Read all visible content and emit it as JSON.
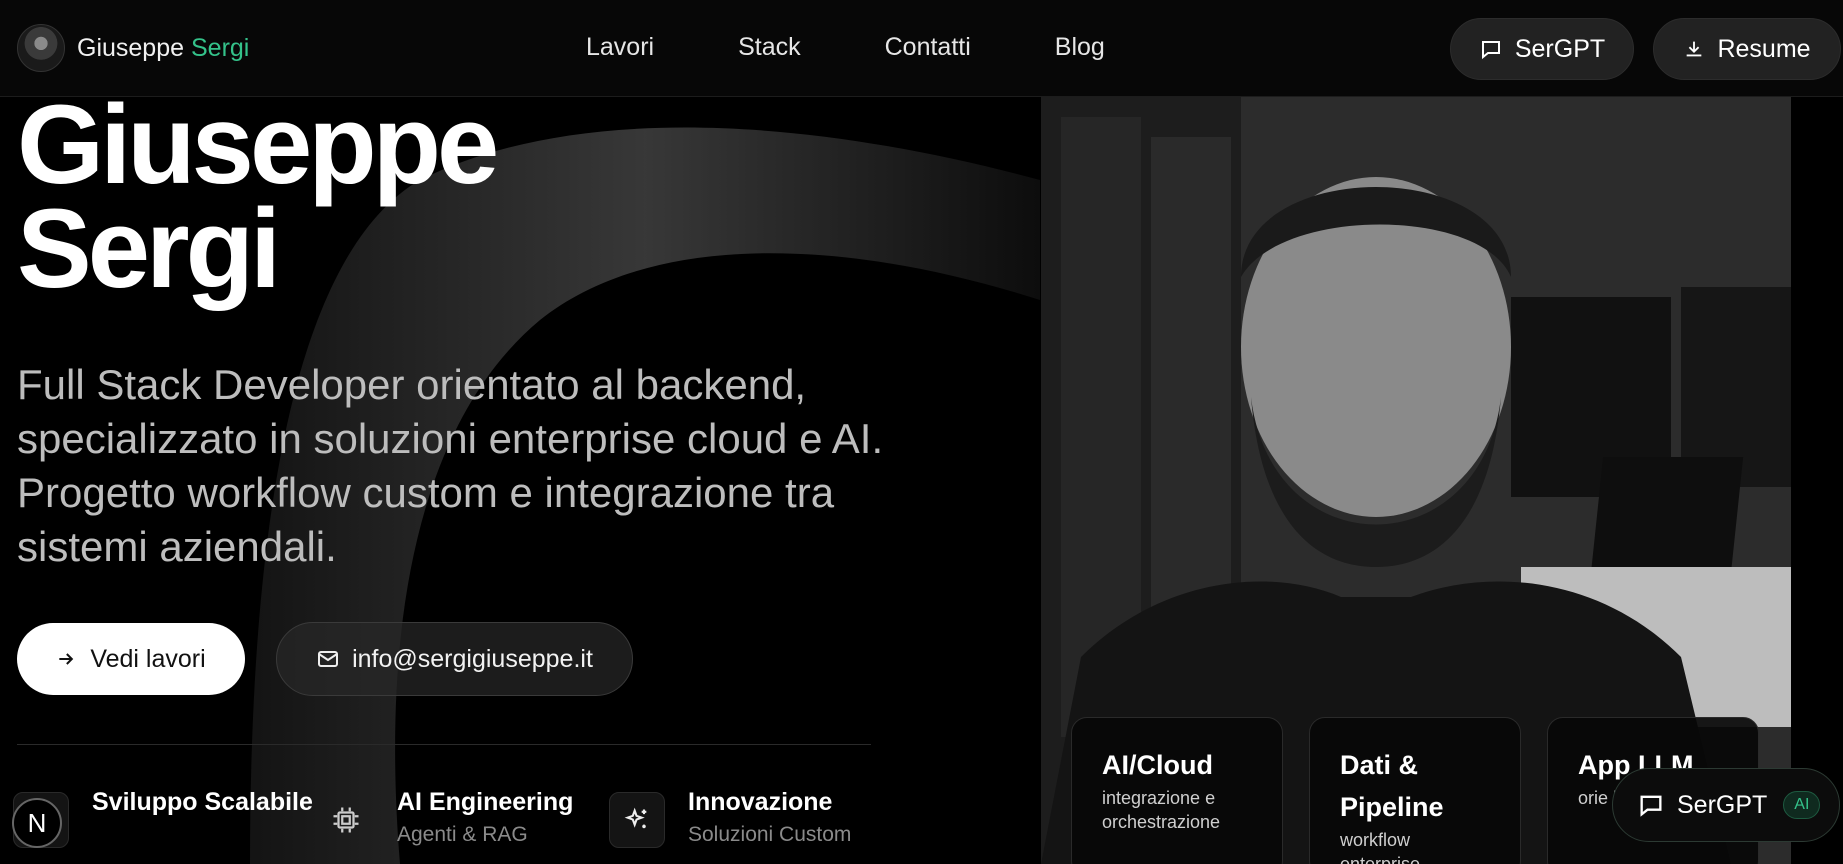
{
  "header": {
    "brand_first": "Giuseppe",
    "brand_last": "Sergi",
    "nav": [
      "Lavori",
      "Stack",
      "Contatti",
      "Blog"
    ],
    "sergpt_label": "SerGPT",
    "resume_label": "Resume"
  },
  "hero": {
    "title_line1": "Giuseppe",
    "title_line2": "Sergi",
    "subtitle": "Full Stack Developer orientato al backend, specializzato in soluzioni enterprise cloud e AI. Progetto workflow custom e integrazione tra sistemi aziendali.",
    "cta_primary": "Vedi lavori",
    "cta_email": "info@sergigiuseppe.it"
  },
  "features": [
    {
      "title": "Sviluppo Scalabile",
      "subtitle": "",
      "icon": "layers-icon"
    },
    {
      "title": "AI Engineering",
      "subtitle": "Agenti & RAG",
      "icon": "chip-icon"
    },
    {
      "title": "Innovazione",
      "subtitle": "Soluzioni Custom",
      "icon": "sparkles-icon"
    }
  ],
  "badge_letter": "N",
  "cards": [
    {
      "title": "AI/Cloud",
      "subtitle": "integrazione e orchestrazione"
    },
    {
      "title": "Dati & Pipeline",
      "subtitle": "workflow enterprise"
    },
    {
      "title": "App LLM",
      "subtitle": "orie busi"
    }
  ],
  "chat_fab": {
    "label": "SerGPT",
    "badge": "AI"
  },
  "colors": {
    "accent": "#34c28a",
    "background": "#000000"
  }
}
